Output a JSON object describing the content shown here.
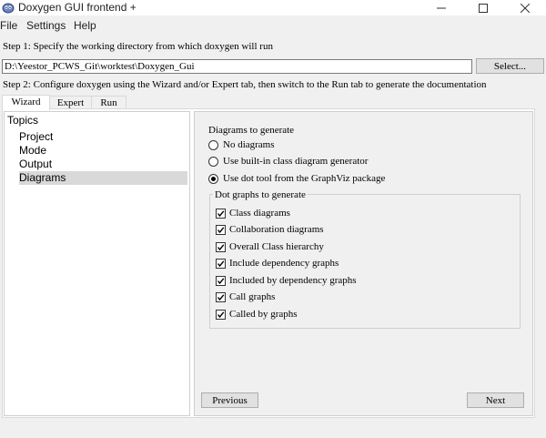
{
  "window": {
    "title": "Doxygen GUI frontend +",
    "icon": "doxygen-app-icon",
    "controls": [
      "minimize-icon",
      "maximize-icon",
      "close-icon"
    ]
  },
  "menu": [
    "File",
    "Settings",
    "Help"
  ],
  "step1": {
    "text": "Step 1: Specify the working directory from which doxygen will run",
    "working_dir": "D:\\Yeestor_PCWS_Git\\worktest\\Doxygen_Gui",
    "select_label": "Select..."
  },
  "step2": {
    "text": "Step 2: Configure doxygen using the Wizard and/or Expert tab, then switch to the Run tab to generate the documentation"
  },
  "tabs": [
    {
      "label": "Wizard",
      "active": true
    },
    {
      "label": "Expert",
      "active": false
    },
    {
      "label": "Run",
      "active": false
    }
  ],
  "topics": {
    "header": "Topics",
    "items": [
      {
        "label": "Project",
        "selected": false
      },
      {
        "label": "Mode",
        "selected": false
      },
      {
        "label": "Output",
        "selected": false
      },
      {
        "label": "Diagrams",
        "selected": true
      }
    ]
  },
  "diagrams": {
    "section_label": "Diagrams to generate",
    "options": [
      {
        "label": "No diagrams",
        "selected": false
      },
      {
        "label": "Use built-in class diagram generator",
        "selected": false
      },
      {
        "label": "Use dot tool from the GraphViz package",
        "selected": true
      }
    ],
    "dot_group_title": "Dot graphs to generate",
    "dot_graphs": [
      {
        "label": "Class diagrams",
        "checked": true
      },
      {
        "label": "Collaboration diagrams",
        "checked": true
      },
      {
        "label": "Overall Class hierarchy",
        "checked": true
      },
      {
        "label": "Include dependency graphs",
        "checked": true
      },
      {
        "label": "Included by dependency graphs",
        "checked": true
      },
      {
        "label": "Call graphs",
        "checked": true
      },
      {
        "label": "Called by graphs",
        "checked": true
      }
    ]
  },
  "nav": {
    "previous_label": "Previous",
    "next_label": "Next"
  },
  "colors": {
    "selection": "#d9d9d9",
    "panel": "#f0f0f0",
    "white": "#ffffff"
  }
}
